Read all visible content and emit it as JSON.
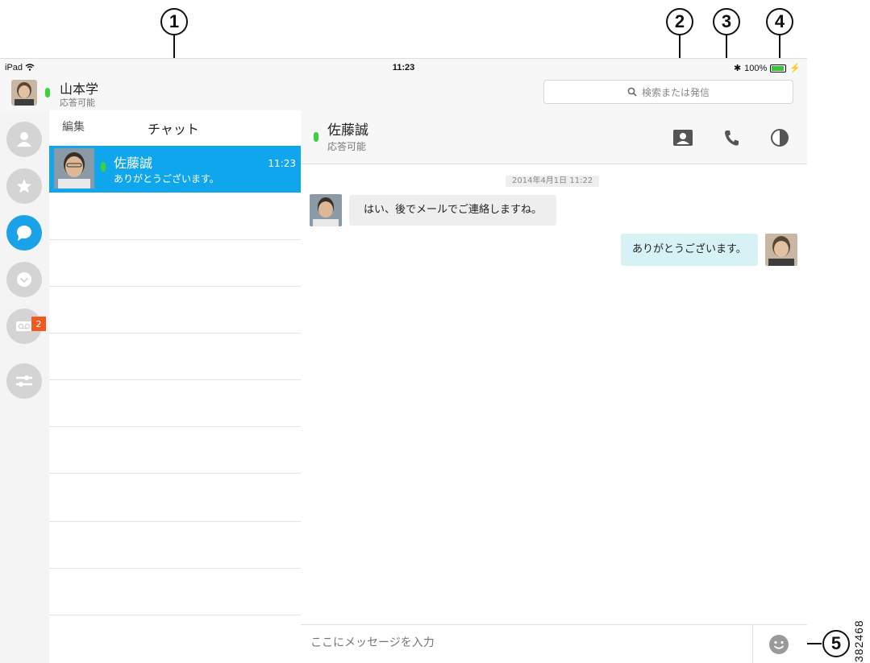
{
  "callouts": [
    "1",
    "2",
    "3",
    "4",
    "5"
  ],
  "figure_id": "382468",
  "statusbar": {
    "device": "iPad",
    "time": "11:23",
    "battery": "100%"
  },
  "me": {
    "name": "山本学",
    "status": "応答可能"
  },
  "search": {
    "placeholder": "検索または発信"
  },
  "nav": {
    "items": [
      {
        "icon": "contacts-icon"
      },
      {
        "icon": "favorites-star-icon"
      },
      {
        "icon": "chat-bubble-icon",
        "active": true
      },
      {
        "icon": "recents-clock-icon"
      },
      {
        "icon": "voicemail-icon",
        "badge": "2"
      },
      {
        "icon": "settings-sliders-icon"
      }
    ]
  },
  "chat_list": {
    "edit": "編集",
    "title": "チャット",
    "items": [
      {
        "name": "佐藤誠",
        "last_message": "ありがとうございます。",
        "time": "11:23"
      }
    ]
  },
  "conversation": {
    "contact_name": "佐藤誠",
    "contact_status": "応答可能",
    "header_icons": [
      "contact-card-icon",
      "phone-icon",
      "contrast-icon"
    ],
    "timestamp": "2014年4月1日 11:22",
    "messages": [
      {
        "direction": "in",
        "text": "はい、後でメールでご連絡しますね。"
      },
      {
        "direction": "out",
        "text": "ありがとうございます。"
      }
    ],
    "composer_placeholder": "ここにメッセージを入力"
  },
  "colors": {
    "accent": "#1aa3e8",
    "selected_row": "#10a6ee",
    "presence": "#3bd23b",
    "badge": "#f05a22",
    "outgoing_bubble": "#d6f2f5"
  }
}
